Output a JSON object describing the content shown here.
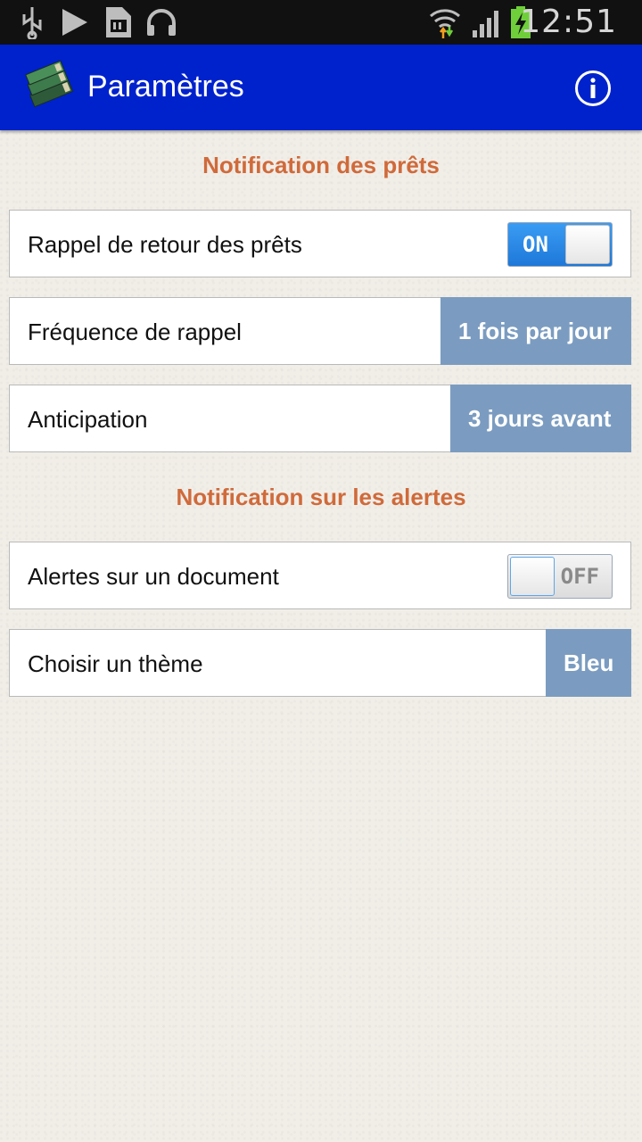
{
  "status_bar": {
    "time": "12:51",
    "icons": [
      "usb-icon",
      "play-icon",
      "sd-card-icon",
      "headphones-icon",
      "wifi-icon",
      "signal-icon",
      "battery-charging-icon"
    ]
  },
  "action_bar": {
    "title": "Paramètres",
    "app_icon": "books-icon",
    "info_icon": "info-icon"
  },
  "sections": {
    "loans": {
      "title": "Notification des prêts",
      "reminder": {
        "label": "Rappel de retour des prêts",
        "toggle": "ON"
      },
      "frequency": {
        "label": "Fréquence de rappel",
        "value": "1 fois par jour"
      },
      "anticipation": {
        "label": "Anticipation",
        "value": "3 jours avant"
      }
    },
    "alerts": {
      "title": "Notification sur les alertes",
      "document_alerts": {
        "label": "Alertes sur un document",
        "toggle": "OFF"
      },
      "theme": {
        "label": "Choisir un thème",
        "value": "Bleu"
      }
    }
  },
  "colors": {
    "action_bar": "#0022cc",
    "section_title": "#d06a3a",
    "value_button": "#7b9cc0",
    "toggle_on": "#1e78d8"
  }
}
